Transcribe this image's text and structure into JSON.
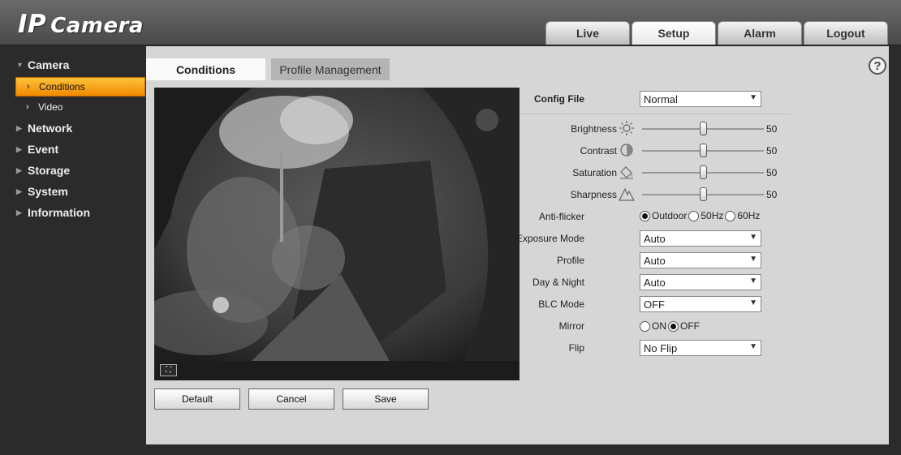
{
  "header": {
    "logo_ip": "IP",
    "logo_camera": "Camera",
    "tabs": [
      {
        "label": "Live",
        "active": false
      },
      {
        "label": "Setup",
        "active": true
      },
      {
        "label": "Alarm",
        "active": false
      },
      {
        "label": "Logout",
        "active": false
      }
    ]
  },
  "sidebar": {
    "camera": "Camera",
    "conditions": "Conditions",
    "video": "Video",
    "network": "Network",
    "event": "Event",
    "storage": "Storage",
    "system": "System",
    "information": "Information"
  },
  "subtabs": {
    "conditions": "Conditions",
    "profile_management": "Profile Management"
  },
  "help_icon": "?",
  "form": {
    "config_file": {
      "label": "Config File",
      "value": "Normal"
    },
    "brightness": {
      "label": "Brightness",
      "value": 50
    },
    "contrast": {
      "label": "Contrast",
      "value": 50
    },
    "saturation": {
      "label": "Saturation",
      "value": 50
    },
    "sharpness": {
      "label": "Sharpness",
      "value": 50
    },
    "anti_flicker": {
      "label": "Anti-flicker",
      "options": [
        "Outdoor",
        "50Hz",
        "60Hz"
      ],
      "selected": "Outdoor"
    },
    "exposure_mode": {
      "label": "Exposure Mode",
      "value": "Auto"
    },
    "profile": {
      "label": "Profile",
      "value": "Auto"
    },
    "day_night": {
      "label": "Day & Night",
      "value": "Auto"
    },
    "blc_mode": {
      "label": "BLC Mode",
      "value": "OFF"
    },
    "mirror": {
      "label": "Mirror",
      "options": [
        "ON",
        "OFF"
      ],
      "selected": "OFF"
    },
    "flip": {
      "label": "Flip",
      "value": "No Flip"
    }
  },
  "buttons": {
    "default": "Default",
    "cancel": "Cancel",
    "save": "Save"
  },
  "colors": {
    "accent_orange": "#f5a000",
    "panel": "#d6d6d6",
    "background": "#2b2b2b"
  }
}
